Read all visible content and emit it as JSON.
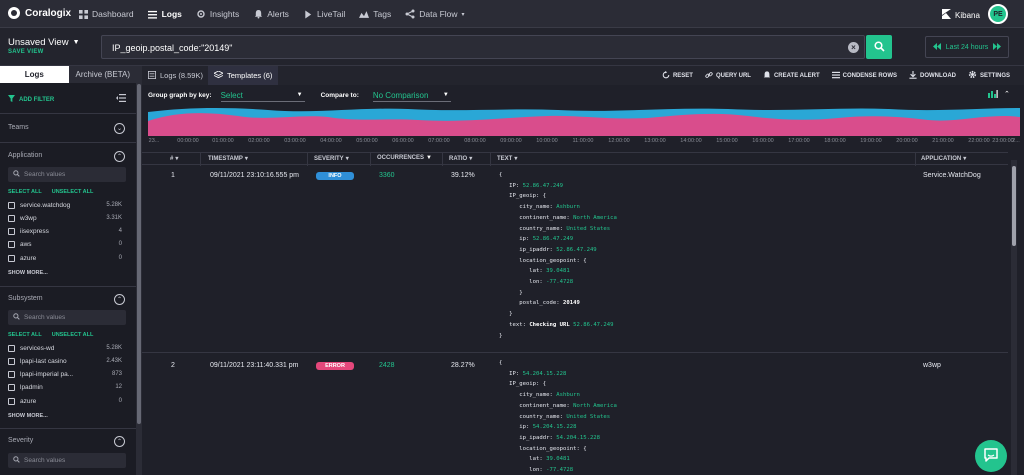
{
  "app": {
    "name": "Coralogix"
  },
  "nav": {
    "items": [
      {
        "label": "Dashboard"
      },
      {
        "label": "Logs"
      },
      {
        "label": "Insights"
      },
      {
        "label": "Alerts"
      },
      {
        "label": "LiveTail"
      },
      {
        "label": "Tags"
      },
      {
        "label": "Data Flow"
      }
    ],
    "kibana": "Kibana",
    "avatar": "PE"
  },
  "view": {
    "title": "Unsaved View",
    "save_label": "SAVE VIEW"
  },
  "query": {
    "value": "IP_geoip.postal_code:\"20149\""
  },
  "time_range": {
    "label": "Last 24 hours"
  },
  "sidebar": {
    "tabs": [
      "Logs",
      "Archive (BETA)"
    ],
    "add_filter": "ADD FILTER",
    "search_placeholder": "Search values",
    "select_all": "SELECT ALL",
    "unselect_all": "UNSELECT ALL",
    "show_more": "SHOW MORE...",
    "sections": {
      "teams": "Teams",
      "application": "Application",
      "subsystem": "Subsystem",
      "severity": "Severity"
    },
    "application_items": [
      {
        "label": "service.watchdog",
        "count": "5.28K"
      },
      {
        "label": "w3wp",
        "count": "3.31K"
      },
      {
        "label": "iisexpress",
        "count": "4"
      },
      {
        "label": "aws",
        "count": "0"
      },
      {
        "label": "azure",
        "count": "0"
      }
    ],
    "subsystem_items": [
      {
        "label": "services-wd",
        "count": "5.28K"
      },
      {
        "label": "lpapi-last casino",
        "count": "2.43K"
      },
      {
        "label": "lpapi-imperial pa...",
        "count": "873"
      },
      {
        "label": "lpadmin",
        "count": "12"
      },
      {
        "label": "azure",
        "count": "0"
      }
    ]
  },
  "main": {
    "tabs": [
      {
        "label": "Logs (8.59K)"
      },
      {
        "label": "Templates (6)"
      }
    ],
    "toolbar": [
      "RESET",
      "QUERY URL",
      "CREATE ALERT",
      "CONDENSE ROWS",
      "DOWNLOAD",
      "SETTINGS"
    ],
    "group_by_label": "Group graph by key:",
    "group_by_value": "Select",
    "compare_label": "Compare to:",
    "compare_value": "No Comparison",
    "time_ticks": [
      "23...",
      "00:00:00",
      "01:00:00",
      "02:00:00",
      "03:00:00",
      "04:00:00",
      "05:00:00",
      "06:00:00",
      "07:00:00",
      "08:00:00",
      "09:00:00",
      "10:00:00",
      "11:00:00",
      "12:00:00",
      "13:00:00",
      "14:00:00",
      "15:00:00",
      "16:00:00",
      "17:00:00",
      "18:00:00",
      "19:00:00",
      "20:00:00",
      "21:00:00",
      "22:00:00",
      "23:00:00",
      "2..."
    ],
    "columns": [
      "#",
      "TIMESTAMP",
      "SEVERITY",
      "OCCURRENCES",
      "RATIO",
      "TEXT",
      "APPLICATION"
    ],
    "rows": [
      {
        "num": "1",
        "timestamp": "09/11/2021 23:10:16.555 pm",
        "severity": "INFO",
        "occurrences": "3360",
        "ratio": "39.12%",
        "application": "Service.WatchDog",
        "ip": "52.86.47.249",
        "city": "Ashburn",
        "continent": "North America",
        "country": "United States",
        "postal": "20149",
        "lat": "39.0481",
        "lon": "-77.4728",
        "text_label": "Checking URL",
        "text_value": "52.86.47.249"
      },
      {
        "num": "2",
        "timestamp": "09/11/2021 23:11:40.331 pm",
        "severity": "ERROR",
        "occurrences": "2428",
        "ratio": "28.27%",
        "application": "w3wp",
        "ip": "54.204.15.228",
        "city": "Ashburn",
        "continent": "North America",
        "country": "United States",
        "lat": "39.0481",
        "lon": "-77.4728"
      }
    ]
  },
  "colors": {
    "accent": "#23c48e",
    "info": "#2f8fd8",
    "error": "#e4477b",
    "chart_pink": "#d94d8c",
    "chart_blue": "#2aa7d6"
  }
}
